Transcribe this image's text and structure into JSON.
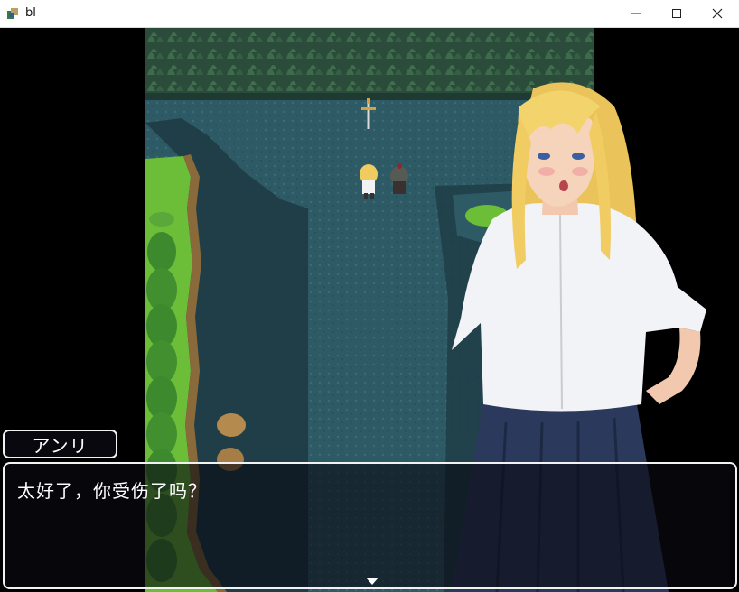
{
  "window": {
    "title": "bl",
    "icons": {
      "app": "app-icon",
      "minimize": "minimize-icon",
      "maximize": "maximize-icon",
      "close": "close-icon"
    }
  },
  "scene": {
    "colors": {
      "water": "#2e5b66",
      "water_dark": "#1e3c44",
      "grass": "#6fbf3a",
      "rock_wall": "#2c4a3a",
      "tree": "#3f8a2f"
    }
  },
  "dialogue": {
    "speaker": "アンリ",
    "text": "太好了，你受伤了吗？",
    "continue_icon": "continue-arrow-icon"
  },
  "portrait": {
    "hair": "#f2cf63",
    "shirt": "#f3f4f6",
    "skirt": "#2c3a5c"
  }
}
